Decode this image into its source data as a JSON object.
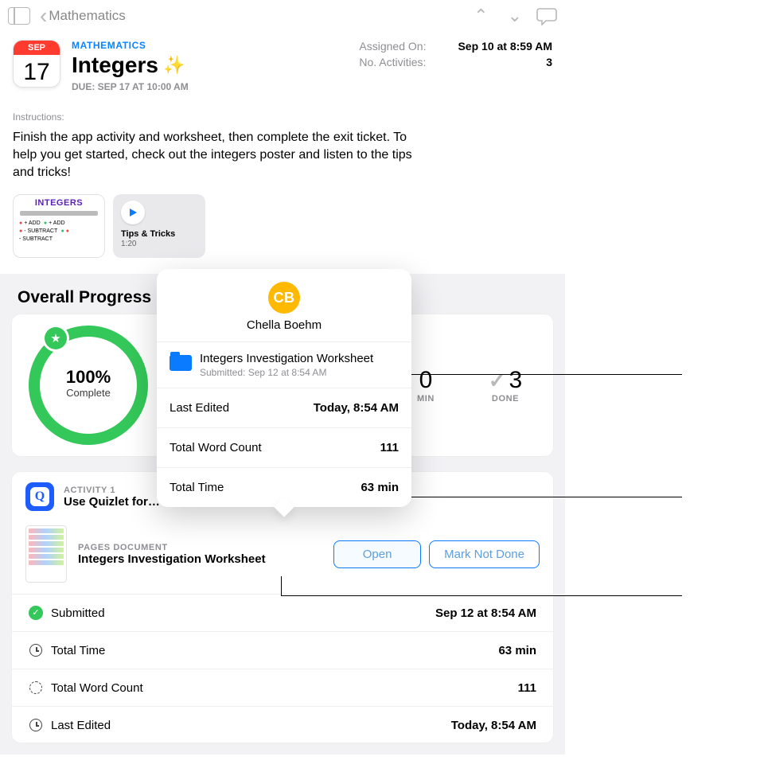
{
  "toolbar": {
    "back_label": "Mathematics"
  },
  "header": {
    "date_month": "SEP",
    "date_day": "17",
    "subject": "MATHEMATICS",
    "title": "Integers",
    "sparkle": "✨",
    "due_text": "DUE: SEP 17 AT 10:00 AM"
  },
  "meta": {
    "assigned_label": "Assigned On:",
    "assigned_value": "Sep 10 at 8:59 AM",
    "activities_label": "No. Activities:",
    "activities_value": "3"
  },
  "instructions": {
    "label": "Instructions:",
    "text": "Finish the app activity and worksheet, then complete the exit ticket. To help you get started, check out the integers poster and listen to the tips and tricks!"
  },
  "attachments": {
    "poster_title": "INTEGERS",
    "media_title": "Tips & Tricks",
    "media_duration": "1:20"
  },
  "progress": {
    "section_title": "Overall Progress",
    "percent": "100%",
    "complete_label": "Complete",
    "min_value": "0",
    "min_label": "MIN",
    "done_value": "3",
    "done_label": "DONE"
  },
  "activity1": {
    "overline": "ACTIVITY 1",
    "name": "Use Quizlet for…"
  },
  "document": {
    "overline": "PAGES DOCUMENT",
    "name": "Integers Investigation Worksheet",
    "open_label": "Open",
    "mark_label": "Mark Not Done"
  },
  "details": {
    "submitted_label": "Submitted",
    "submitted_value": "Sep 12 at 8:54 AM",
    "time_label": "Total Time",
    "time_value": "63 min",
    "words_label": "Total Word Count",
    "words_value": "111",
    "edited_label": "Last Edited",
    "edited_value": "Today, 8:54 AM"
  },
  "popover": {
    "initials": "CB",
    "name": "Chella Boehm",
    "file_title": "Integers Investigation Worksheet",
    "file_sub": "Submitted: Sep 12 at 8:54 AM",
    "row_edited_label": "Last Edited",
    "row_edited_value": "Today, 8:54 AM",
    "row_words_label": "Total Word Count",
    "row_words_value": "111",
    "row_time_label": "Total Time",
    "row_time_value": "63 min"
  }
}
